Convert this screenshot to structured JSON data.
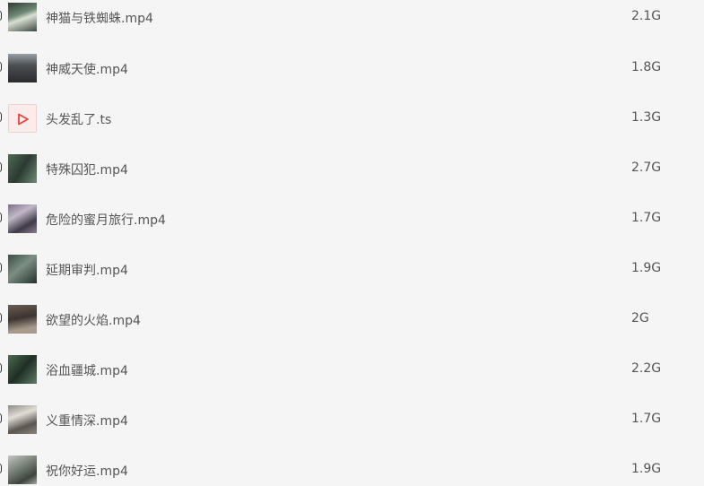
{
  "files": [
    {
      "name": "神猫与铁蜘蛛.mp4",
      "size": "2.1G",
      "icon": "video-thumbnail"
    },
    {
      "name": "神威天使.mp4",
      "size": "1.8G",
      "icon": "video-thumbnail"
    },
    {
      "name": "头发乱了.ts",
      "size": "1.3G",
      "icon": "play-file-icon"
    },
    {
      "name": "特殊囚犯.mp4",
      "size": "2.7G",
      "icon": "video-thumbnail"
    },
    {
      "name": "危险的蜜月旅行.mp4",
      "size": "1.7G",
      "icon": "video-thumbnail"
    },
    {
      "name": "延期审判.mp4",
      "size": "1.9G",
      "icon": "video-thumbnail"
    },
    {
      "name": "欲望的火焰.mp4",
      "size": "2G",
      "icon": "video-thumbnail"
    },
    {
      "name": "浴血疆城.mp4",
      "size": "2.2G",
      "icon": "video-thumbnail"
    },
    {
      "name": "义重情深.mp4",
      "size": "1.7G",
      "icon": "video-thumbnail"
    },
    {
      "name": "祝你好运.mp4",
      "size": "1.9G",
      "icon": "video-thumbnail"
    }
  ],
  "colors": {
    "background": "#f5f5f5",
    "text": "#555555",
    "ts_icon_accent": "#e0463a"
  }
}
